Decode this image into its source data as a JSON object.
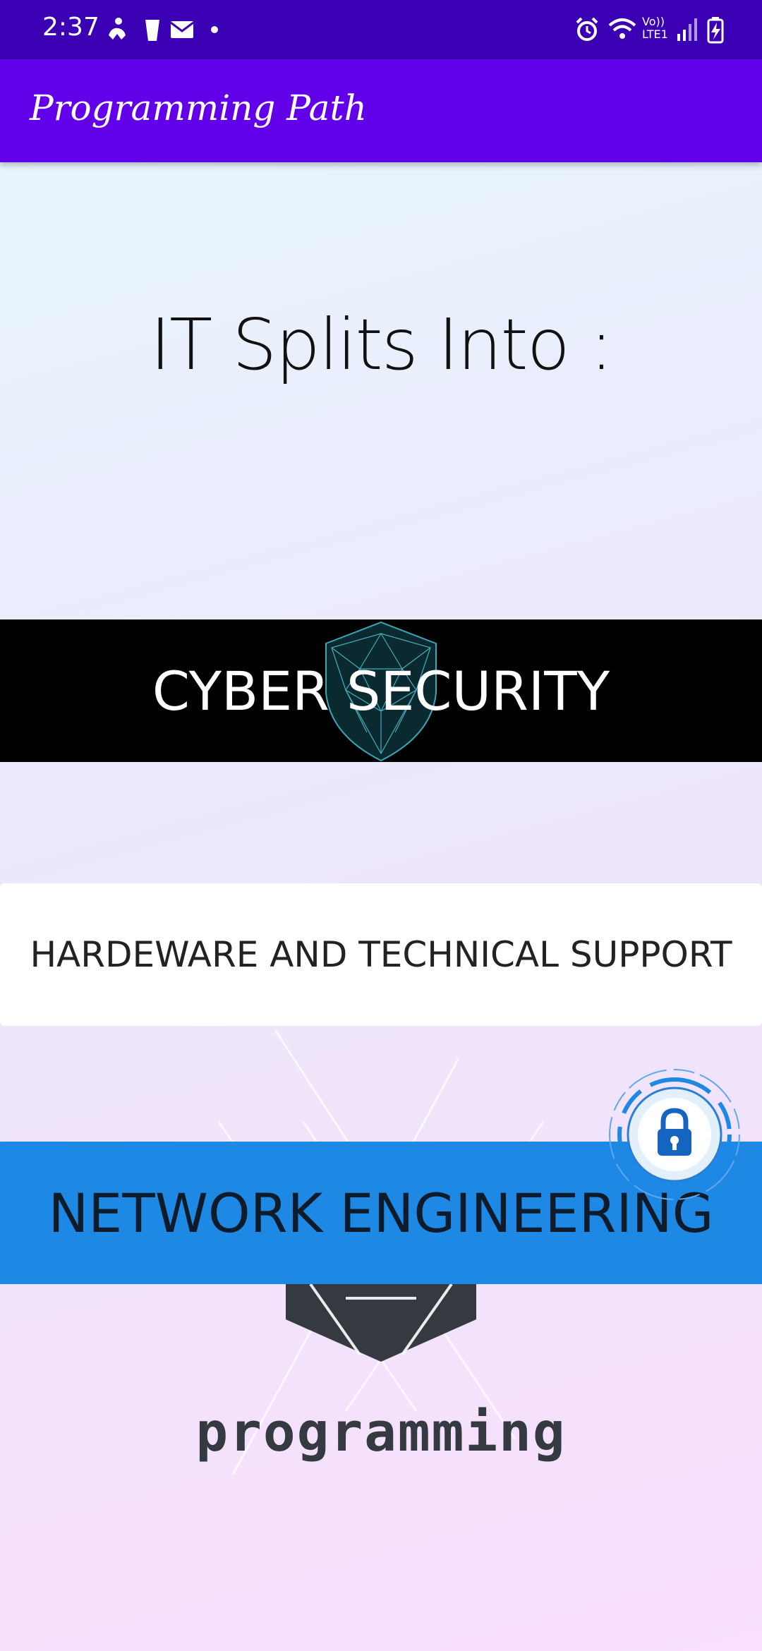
{
  "status_bar": {
    "time": "2:37",
    "network_label": "Vo)) LTE1",
    "icons": [
      "accessibility-icon",
      "clipboard-icon",
      "mail-icon",
      "dot-icon",
      "alarm-icon",
      "wifi-icon",
      "signal-icon",
      "battery-charging-icon"
    ]
  },
  "app_bar": {
    "title": "Programming Path"
  },
  "main": {
    "heading": "IT Splits Into :",
    "options": [
      {
        "label": "CYBER SECURITY"
      },
      {
        "label": "HARDEWARE AND TECHNICAL SUPPORT"
      },
      {
        "label": "NETWORK ENGINEERING"
      }
    ],
    "logo_text": "programming"
  },
  "colors": {
    "status_bar": "#3b00b3",
    "app_bar": "#6200ea",
    "cyber_band": "#000000",
    "hardware_band": "#ffffff",
    "network_band": "#1e88e5"
  }
}
